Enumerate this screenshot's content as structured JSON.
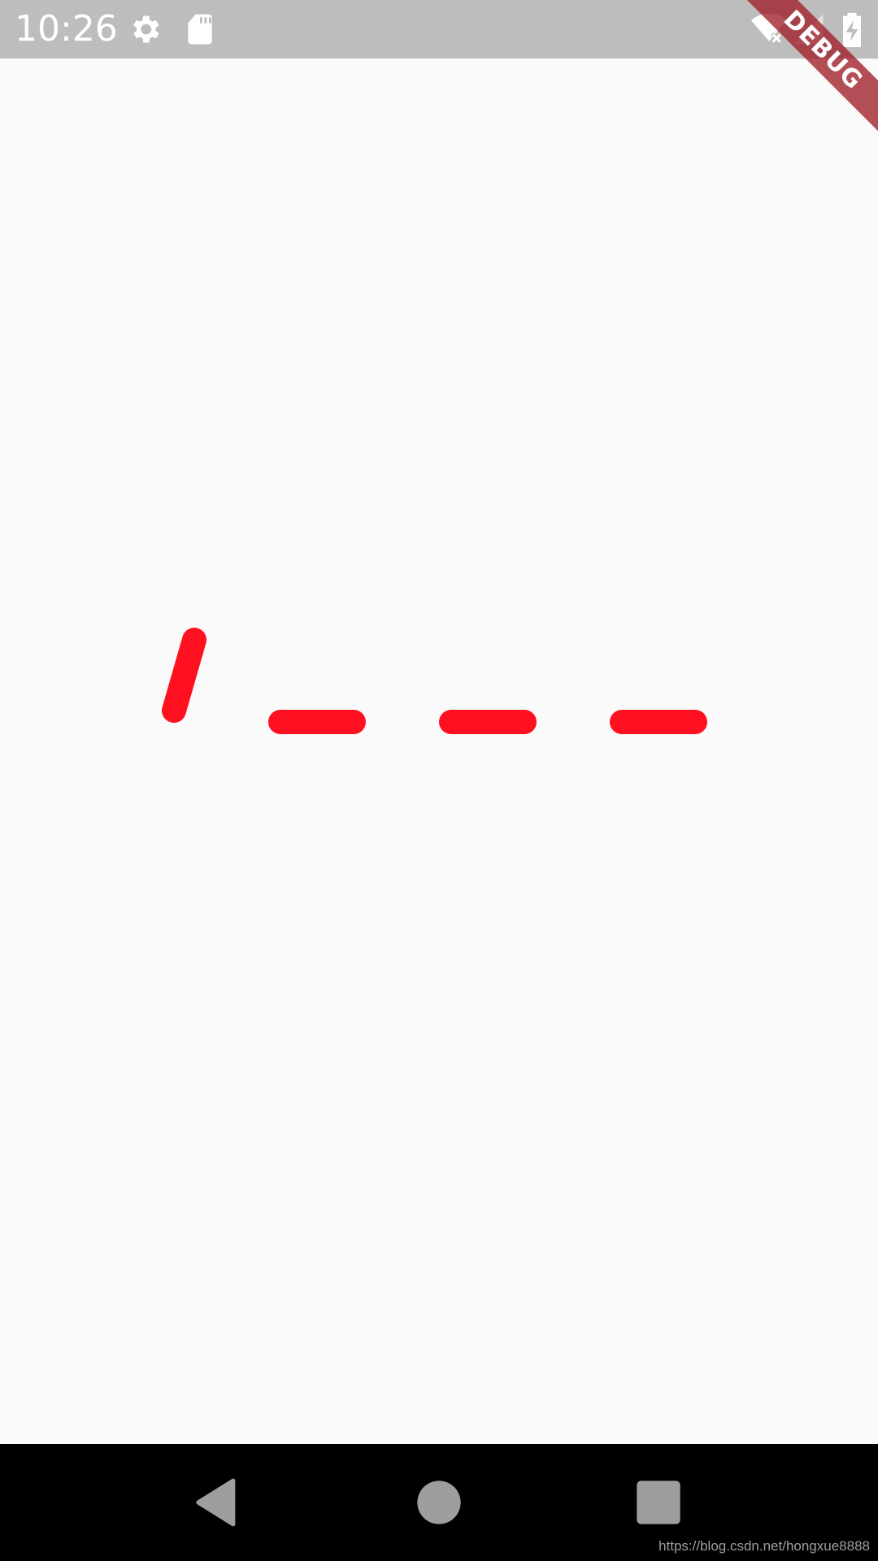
{
  "status_bar": {
    "time": "10:26",
    "icons": [
      "gear-icon",
      "sd-card-icon",
      "wifi-off-icon",
      "signal-icon",
      "battery-charging-icon"
    ],
    "background": "#bdbdbd"
  },
  "debug_banner": {
    "label": "DEBUG",
    "color": "#a01e28"
  },
  "canvas": {
    "background": "#fafafa",
    "stroke_color": "#ff1020"
  },
  "nav_bar": {
    "icons": [
      "back-icon",
      "home-icon",
      "recents-icon"
    ],
    "background": "#000000"
  },
  "watermark": {
    "text": "https://blog.csdn.net/hongxue8888"
  }
}
